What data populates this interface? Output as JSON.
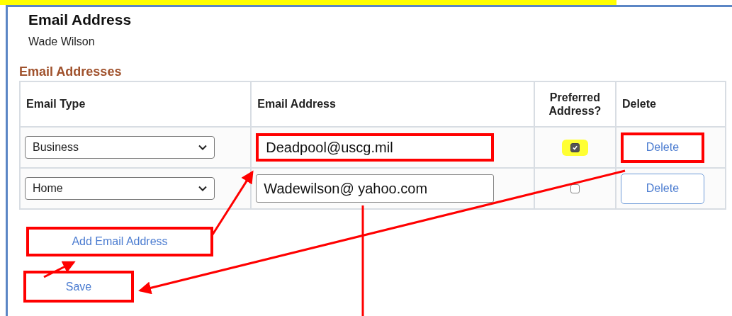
{
  "page": {
    "title": "Email Address",
    "person": "Wade Wilson"
  },
  "section": {
    "title": "Email Addresses",
    "columns": [
      "Email Type",
      "Email Address",
      "Preferred Address?",
      "Delete"
    ],
    "rows": [
      {
        "type": "Business",
        "email": "Deadpool@uscg.mil",
        "preferred": true,
        "preferred_highlighted": true,
        "email_annotated": true,
        "delete_label": "Delete",
        "delete_annotated": true
      },
      {
        "type": "Home",
        "email": "Wadewilson@ yahoo.com",
        "preferred": false,
        "preferred_highlighted": false,
        "email_annotated": false,
        "delete_label": "Delete",
        "delete_annotated": false
      }
    ]
  },
  "buttons": [
    {
      "label": "Add Email Address",
      "kind": "add",
      "annotated": true
    },
    {
      "label": "Save",
      "kind": "save",
      "annotated": true
    }
  ]
}
